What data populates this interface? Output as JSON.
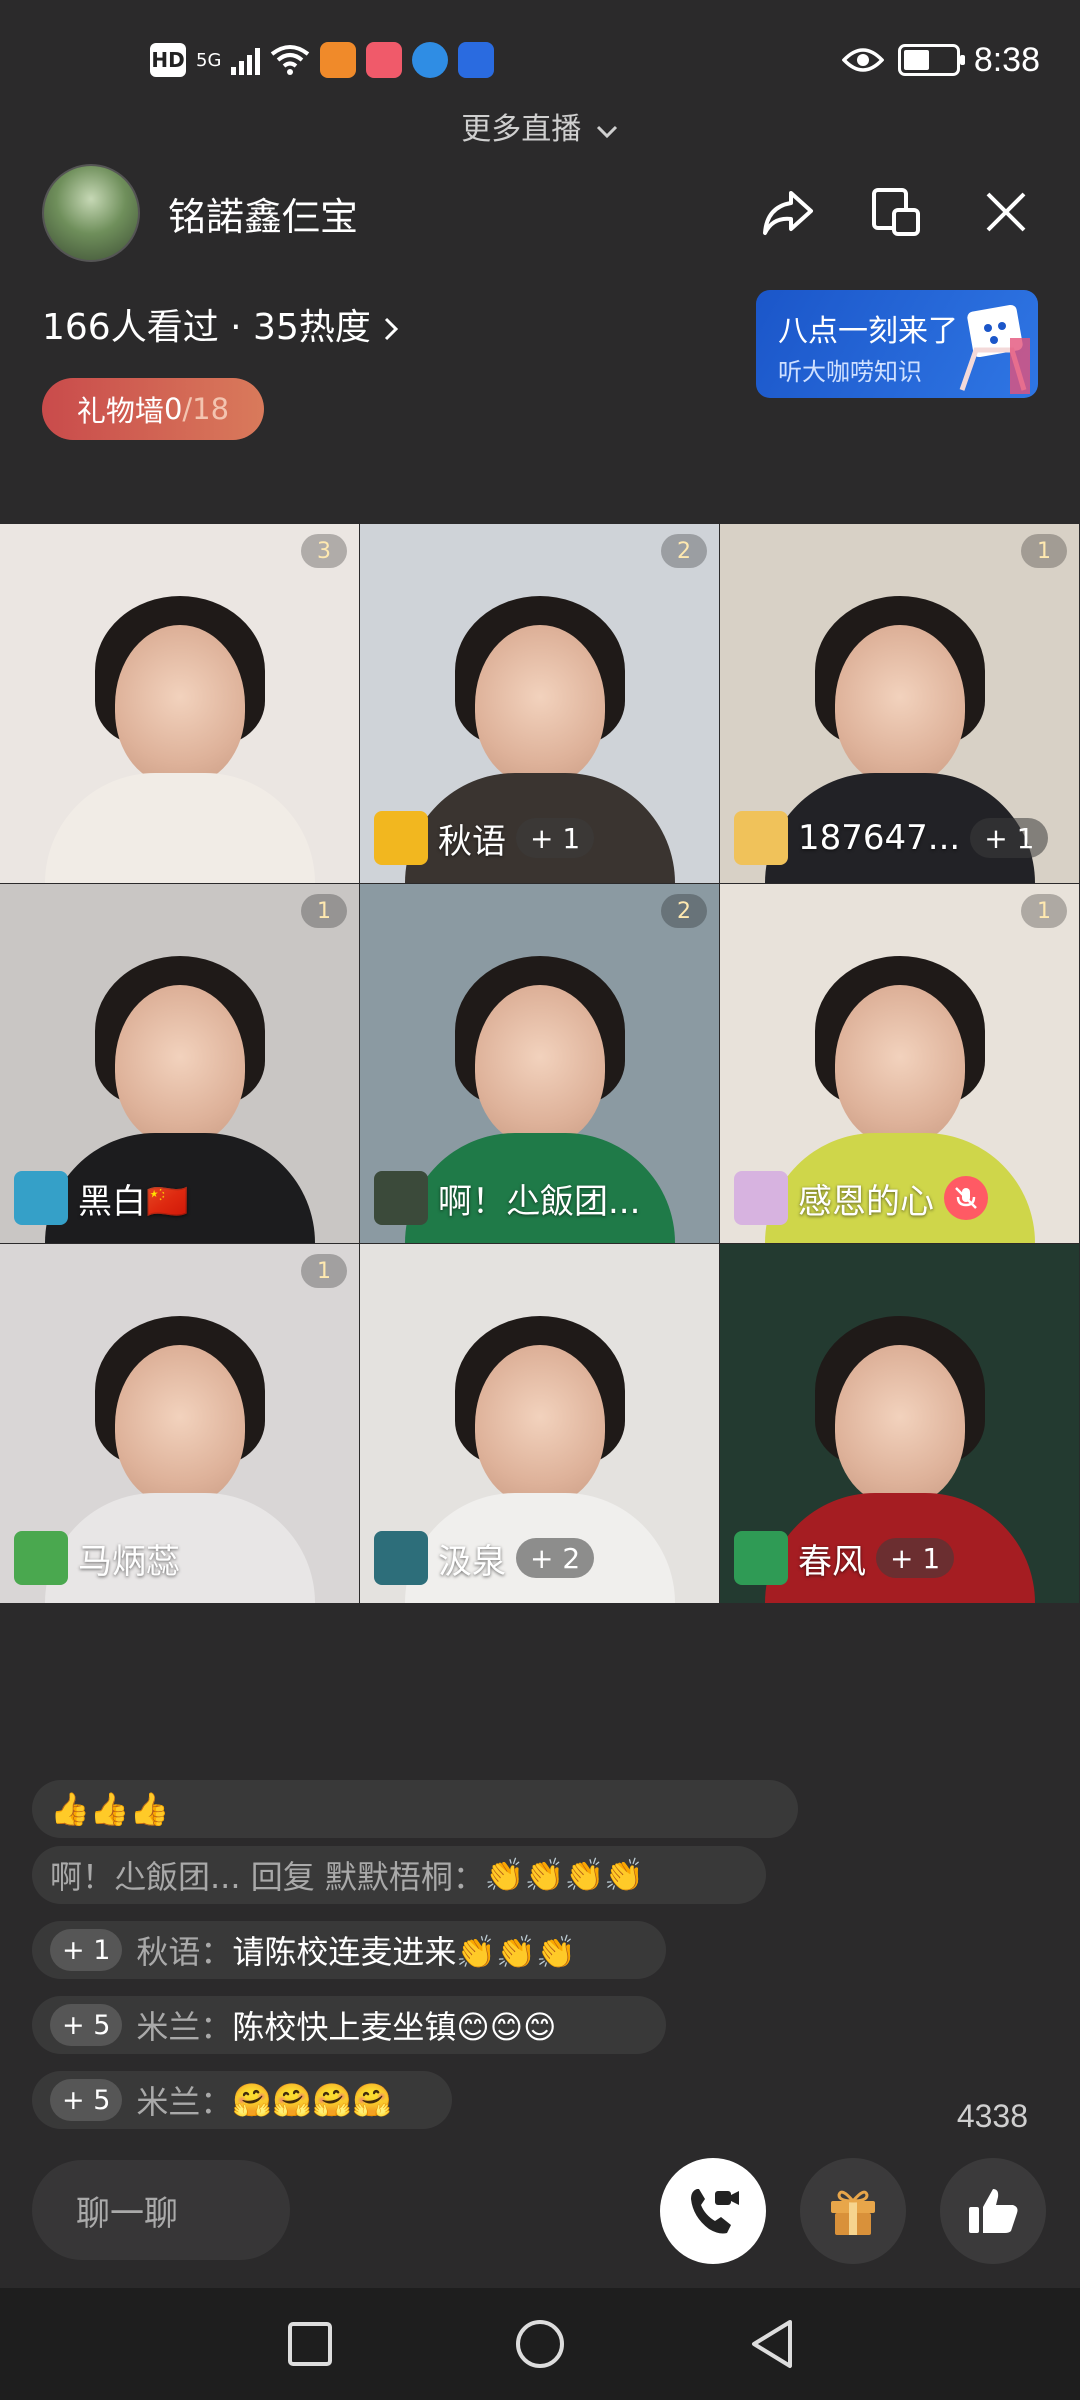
{
  "status_bar": {
    "hd": "HD",
    "network": "5G",
    "time": "8:38",
    "battery_level": 0.5
  },
  "more_live": "更多直播",
  "header": {
    "room_name": "铭諾鑫仨宝",
    "viewers_text": "166人看过 · 35热度",
    "gift_wall_label": "礼物墙",
    "gift_wall_current": "0",
    "gift_wall_total": "/18",
    "promo_title": "八点一刻来了",
    "promo_subtitle": "听大咖唠知识",
    "icons": [
      "share-icon",
      "picture-in-picture-icon",
      "close-icon"
    ]
  },
  "tiles": [
    {
      "badge": "3",
      "name": "",
      "level": "",
      "bg": "#ebe6e2",
      "shirt": "#f1ece6"
    },
    {
      "badge": "2",
      "name": "秋语",
      "level": "+ 1",
      "bg": "#cfd3d8",
      "shirt": "#3a3430"
    },
    {
      "badge": "1",
      "name": "187647...",
      "level": "+ 1",
      "bg": "#d8d1c6",
      "shirt": "#222226"
    },
    {
      "badge": "1",
      "name": "黑白🇨🇳",
      "level": "",
      "bg": "#c9c6c4",
      "shirt": "#1c1c1e"
    },
    {
      "badge": "2",
      "name": "啊！尐飯团...",
      "level": "",
      "bg": "#8b9aa2",
      "shirt": "#1f7a48"
    },
    {
      "badge": "1",
      "name": "感恩的心",
      "level": "",
      "bg": "#e8e2da",
      "shirt": "#cfd64a"
    },
    {
      "badge": "1",
      "name": "马炳蕊",
      "level": "",
      "bg": "#d9d6d6",
      "shirt": "#e8e6e6"
    },
    {
      "badge": "",
      "name": "汲泉",
      "level": "+ 2",
      "bg": "#e4e2df",
      "shirt": "#f0efed"
    },
    {
      "badge": "",
      "name": "春风",
      "level": "+ 1",
      "bg": "#233a30",
      "shirt": "#a51d22"
    }
  ],
  "chat": [
    {
      "level": "",
      "user": "",
      "text": "👍👍👍"
    },
    {
      "level": "",
      "user": "啊！尐飯团... 回复 默默梧桐：",
      "text": "👏👏👏👏"
    },
    {
      "level": "+ 1",
      "user": "秋语：",
      "text": "请陈校连麦进来👏👏👏"
    },
    {
      "level": "+ 5",
      "user": "米兰：",
      "text": "陈校快上麦坐镇😊😊😊"
    },
    {
      "level": "+ 5",
      "user": "米兰：",
      "text": "🤗🤗🤗🤗"
    }
  ],
  "likes_count": "4338",
  "chat_input_placeholder": "聊一聊",
  "bottom_buttons": [
    "video-call-icon",
    "gift-icon",
    "thumbs-up-icon"
  ],
  "nav": [
    "recent-apps-icon",
    "home-icon",
    "back-icon"
  ]
}
